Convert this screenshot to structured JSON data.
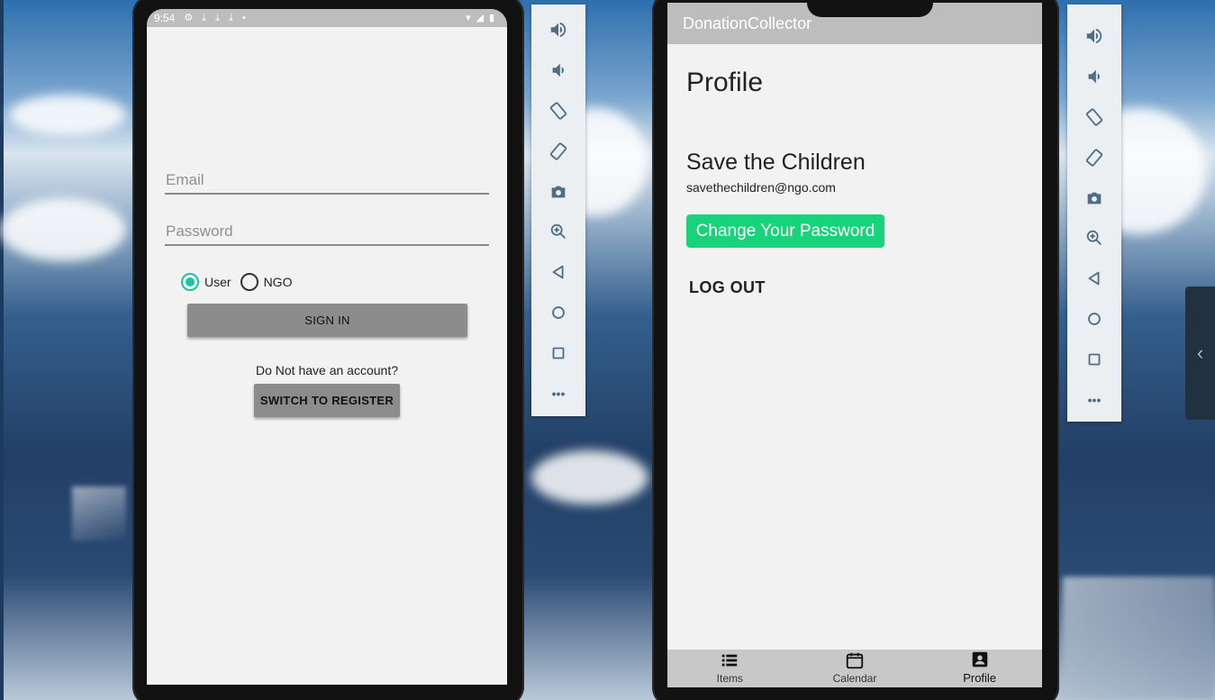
{
  "login_screen": {
    "status_bar": {
      "time": "9:54",
      "icons": [
        "gear-icon",
        "download-icon",
        "download-icon",
        "download-icon",
        "dot-icon",
        "wifi-icon",
        "signal-icon",
        "battery-icon"
      ]
    },
    "email_placeholder": "Email",
    "password_placeholder": "Password",
    "role_options": [
      {
        "label": "User",
        "selected": true
      },
      {
        "label": "NGO",
        "selected": false
      }
    ],
    "sign_in_label": "SIGN IN",
    "register_prompt": "Do Not have an account?",
    "switch_label": "SWITCH TO REGISTER",
    "accent_color": "#19c4a0"
  },
  "emulator_toolbar": {
    "buttons": [
      "volume-up-icon",
      "volume-down-icon",
      "rotate-left-icon",
      "rotate-right-icon",
      "camera-icon",
      "zoom-icon",
      "back-icon",
      "home-icon",
      "overview-icon",
      "more-icon"
    ],
    "more_label": "•••"
  },
  "profile_screen": {
    "app_title": "DonationCollector",
    "page_title": "Profile",
    "org_name": "Save the Children",
    "org_email": "savethechildren@ngo.com",
    "change_password_label": "Change Your Password",
    "logout_label": "LOG OUT",
    "button_color": "#18d37a",
    "nav": [
      {
        "label": "Items",
        "icon": "list-icon",
        "active": false
      },
      {
        "label": "Calendar",
        "icon": "calendar-icon",
        "active": false
      },
      {
        "label": "Profile",
        "icon": "profile-icon",
        "active": true
      }
    ]
  },
  "side_panel": {
    "toggle_icon": "chevron-left-icon",
    "glyph": "‹"
  }
}
